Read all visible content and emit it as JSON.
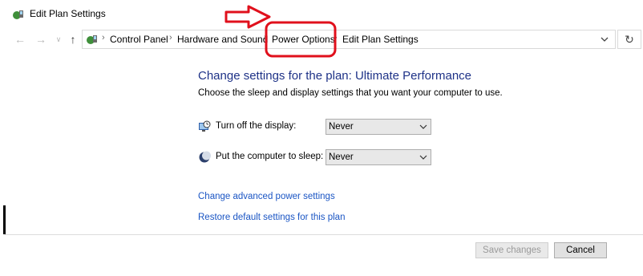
{
  "window": {
    "title": "Edit Plan Settings"
  },
  "breadcrumb": [
    "Control Panel",
    "Hardware and Sound",
    "Power Options",
    "Edit Plan Settings"
  ],
  "main": {
    "heading": "Change settings for the plan: Ultimate Performance",
    "subheading": "Choose the sleep and display settings that you want your computer to use.",
    "settings": [
      {
        "label": "Turn off the display:",
        "value": "Never",
        "icon": "monitor-clock-icon"
      },
      {
        "label": "Put the computer to sleep:",
        "value": "Never",
        "icon": "moon-sleep-icon"
      }
    ],
    "links": [
      "Change advanced power settings",
      "Restore default settings for this plan"
    ]
  },
  "footer": {
    "save_label": "Save changes",
    "cancel_label": "Cancel"
  },
  "colors": {
    "heading": "#1e3287",
    "link": "#1a55c4",
    "annotation": "#e0101c"
  }
}
